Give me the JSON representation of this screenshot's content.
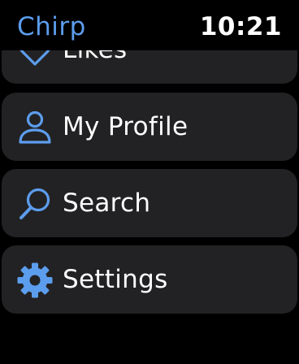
{
  "header": {
    "app_title": "Chirp",
    "time": "10:21"
  },
  "menu": {
    "items": [
      {
        "label": "Likes",
        "icon": "heart-icon"
      },
      {
        "label": "My Profile",
        "icon": "person-icon"
      },
      {
        "label": "Search",
        "icon": "search-icon"
      },
      {
        "label": "Settings",
        "icon": "gear-icon"
      }
    ]
  },
  "colors": {
    "accent": "#5c9ded",
    "card_background": "#222224",
    "background": "#000000",
    "text": "#ffffff"
  }
}
